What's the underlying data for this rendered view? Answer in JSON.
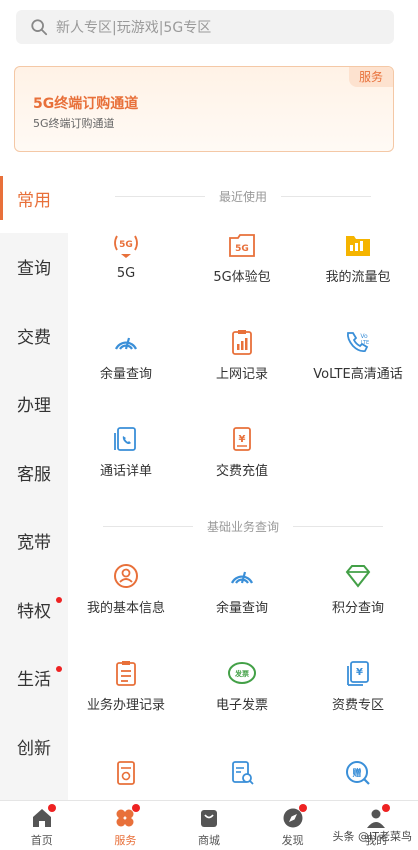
{
  "search": {
    "placeholder": "新人专区|玩游戏|5G专区"
  },
  "banner": {
    "tag": "服务",
    "title": "5G终端订购通道",
    "subtitle": "5G终端订购通道"
  },
  "sidebar": {
    "items": [
      {
        "label": "常用",
        "active": true,
        "dot": false
      },
      {
        "label": "查询",
        "active": false,
        "dot": false
      },
      {
        "label": "交费",
        "active": false,
        "dot": false
      },
      {
        "label": "办理",
        "active": false,
        "dot": false
      },
      {
        "label": "客服",
        "active": false,
        "dot": false
      },
      {
        "label": "宽带",
        "active": false,
        "dot": false
      },
      {
        "label": "特权",
        "active": false,
        "dot": true
      },
      {
        "label": "生活",
        "active": false,
        "dot": true
      },
      {
        "label": "创新",
        "active": false,
        "dot": false
      }
    ]
  },
  "sections": [
    {
      "title": "最近使用",
      "items": [
        {
          "label": "5G",
          "icon": "5g-signal-icon"
        },
        {
          "label": "5G体验包",
          "icon": "5g-package-icon"
        },
        {
          "label": "我的流量包",
          "icon": "data-folder-icon"
        },
        {
          "label": "余量查询",
          "icon": "balance-gauge-icon"
        },
        {
          "label": "上网记录",
          "icon": "clipboard-chart-icon"
        },
        {
          "label": "VoLTE高清通话",
          "icon": "volte-phone-icon"
        },
        {
          "label": "通话详单",
          "icon": "call-detail-icon"
        },
        {
          "label": "交费充值",
          "icon": "yuan-recharge-icon"
        }
      ]
    },
    {
      "title": "基础业务查询",
      "items": [
        {
          "label": "我的基本信息",
          "icon": "user-info-icon"
        },
        {
          "label": "余量查询",
          "icon": "balance-gauge-icon"
        },
        {
          "label": "积分查询",
          "icon": "diamond-points-icon"
        },
        {
          "label": "业务办理记录",
          "icon": "business-record-icon"
        },
        {
          "label": "电子发票",
          "icon": "e-invoice-icon"
        },
        {
          "label": "资费专区",
          "icon": "tariff-icon"
        },
        {
          "label": "",
          "icon": "document-stamp-icon"
        },
        {
          "label": "",
          "icon": "search-doc-icon"
        },
        {
          "label": "",
          "icon": "gift-search-icon"
        }
      ]
    }
  ],
  "tabbar": {
    "items": [
      {
        "label": "首页",
        "icon": "home-icon",
        "dot": true,
        "active": false
      },
      {
        "label": "服务",
        "icon": "service-icon",
        "dot": true,
        "active": true
      },
      {
        "label": "商城",
        "icon": "shop-bag-icon",
        "dot": false,
        "active": false
      },
      {
        "label": "发现",
        "icon": "compass-icon",
        "dot": true,
        "active": false
      },
      {
        "label": "我的",
        "icon": "user-icon",
        "dot": true,
        "active": false
      }
    ]
  },
  "watermark": "头条 @IT老菜鸟",
  "colors": {
    "accent": "#e8703a",
    "blue": "#3a8fd8",
    "green": "#43a047",
    "red_dot": "#ee2222"
  }
}
